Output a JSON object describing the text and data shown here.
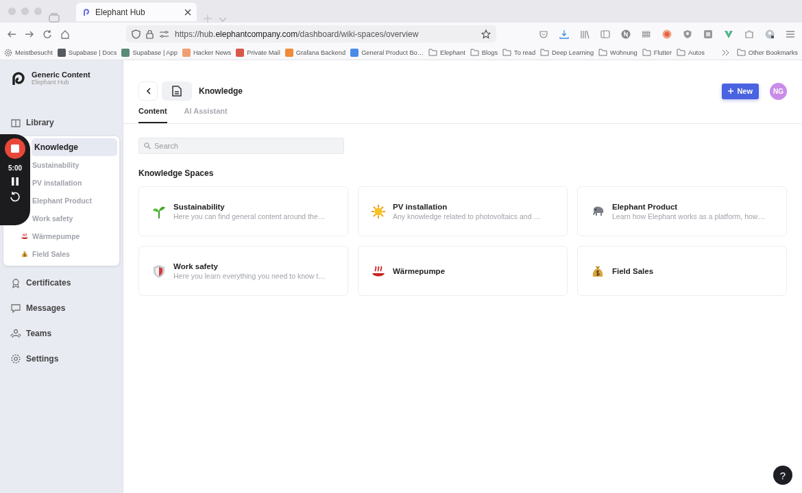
{
  "browser": {
    "tab": {
      "title": "Elephant Hub",
      "selected": true
    },
    "url": "https://hub.**elephantcompany.com**/dashboard/wiki-spaces/overview",
    "bookmarks": [
      {
        "label": "Meistbesucht",
        "kind": "gear"
      },
      {
        "label": "Supabase | Docs",
        "kind": "site",
        "color": "#555a60"
      },
      {
        "label": "Supabase | App",
        "kind": "site",
        "color": "#5a8a78"
      },
      {
        "label": "Hacker News",
        "kind": "site",
        "color": "#f0a070"
      },
      {
        "label": "Private Mail",
        "kind": "site",
        "color": "#d9584a"
      },
      {
        "label": "Grafana Backend",
        "kind": "site",
        "color": "#f08a3a"
      },
      {
        "label": "General Product Bo…",
        "kind": "site",
        "color": "#4a8be8"
      },
      {
        "label": "Elephant",
        "kind": "folder"
      },
      {
        "label": "Blogs",
        "kind": "folder"
      },
      {
        "label": "To read",
        "kind": "folder"
      },
      {
        "label": "Deep Learning",
        "kind": "folder"
      },
      {
        "label": "Wohnung",
        "kind": "folder"
      },
      {
        "label": "Flutter",
        "kind": "folder"
      },
      {
        "label": "Autos",
        "kind": "folder"
      }
    ],
    "other_bookmarks": "Other Bookmarks"
  },
  "sidebar": {
    "org": "Generic Content",
    "app": "Elephant Hub",
    "items": [
      {
        "label": "Library",
        "selected": false
      },
      {
        "label": "Knowledge",
        "selected": true,
        "expanded": true,
        "children": [
          {
            "label": "Sustainability",
            "selected": false
          },
          {
            "label": "PV installation",
            "selected": false
          },
          {
            "label": "Elephant Product",
            "selected": false
          },
          {
            "label": "Work safety",
            "selected": false
          },
          {
            "label": "Wärmepumpe",
            "selected": false
          },
          {
            "label": "Field Sales",
            "selected": false
          }
        ]
      },
      {
        "label": "Certificates",
        "selected": false
      },
      {
        "label": "Messages",
        "selected": false
      },
      {
        "label": "Teams",
        "selected": false
      },
      {
        "label": "Settings",
        "selected": false
      }
    ]
  },
  "recorder": {
    "time": "5:00"
  },
  "header": {
    "title": "Knowledge",
    "new_button": "New",
    "avatar": "NG"
  },
  "tabs": [
    {
      "label": "Content",
      "selected": true
    },
    {
      "label": "AI Assistant",
      "selected": false
    }
  ],
  "search": {
    "placeholder": "Search"
  },
  "section_title": "Knowledge Spaces",
  "spaces": [
    {
      "title": "Sustainability",
      "description": "Here you can find general content around the…"
    },
    {
      "title": "PV installation",
      "description": "Any knowledge related to photovoltaics and …"
    },
    {
      "title": "Elephant Product",
      "description": "Learn how Elephant works as a platform, how…"
    },
    {
      "title": "Work safety",
      "description": "Here you learn everything you need to know t…"
    },
    {
      "title": "Wärmepumpe"
    },
    {
      "title": "Field Sales"
    }
  ],
  "help": "?"
}
